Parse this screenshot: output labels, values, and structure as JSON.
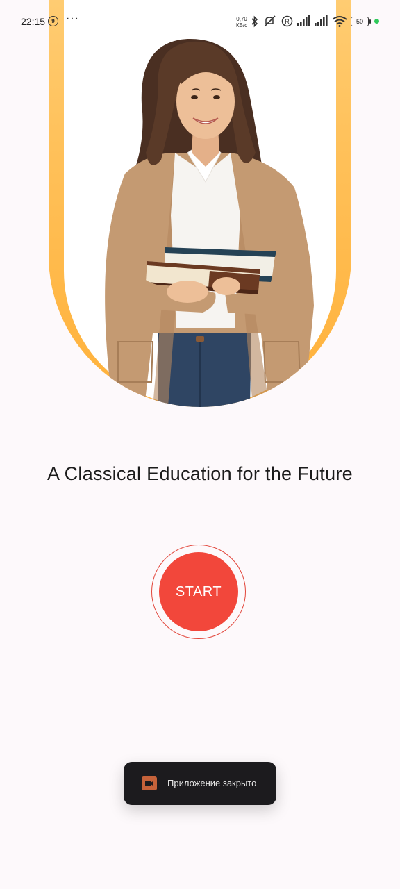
{
  "status_bar": {
    "time": "22:15",
    "notification_count": "9",
    "more": "···",
    "net_speed_value": "0,70",
    "net_speed_unit": "КБ/с",
    "battery": "50",
    "icons": [
      "bluetooth-icon",
      "mute-icon",
      "registered-icon",
      "signal-icon",
      "signal-icon",
      "wifi-icon",
      "battery-icon"
    ]
  },
  "hero": {
    "image": "student-holding-books",
    "arch_color_top": "#ffd98e",
    "arch_color_bottom": "#ffb13a"
  },
  "main": {
    "title": "A Classical Education for the Future",
    "start_label": "START",
    "accent_color": "#f2473b"
  },
  "toast": {
    "icon": "video-camera-icon",
    "message": "Приложение закрыто"
  }
}
